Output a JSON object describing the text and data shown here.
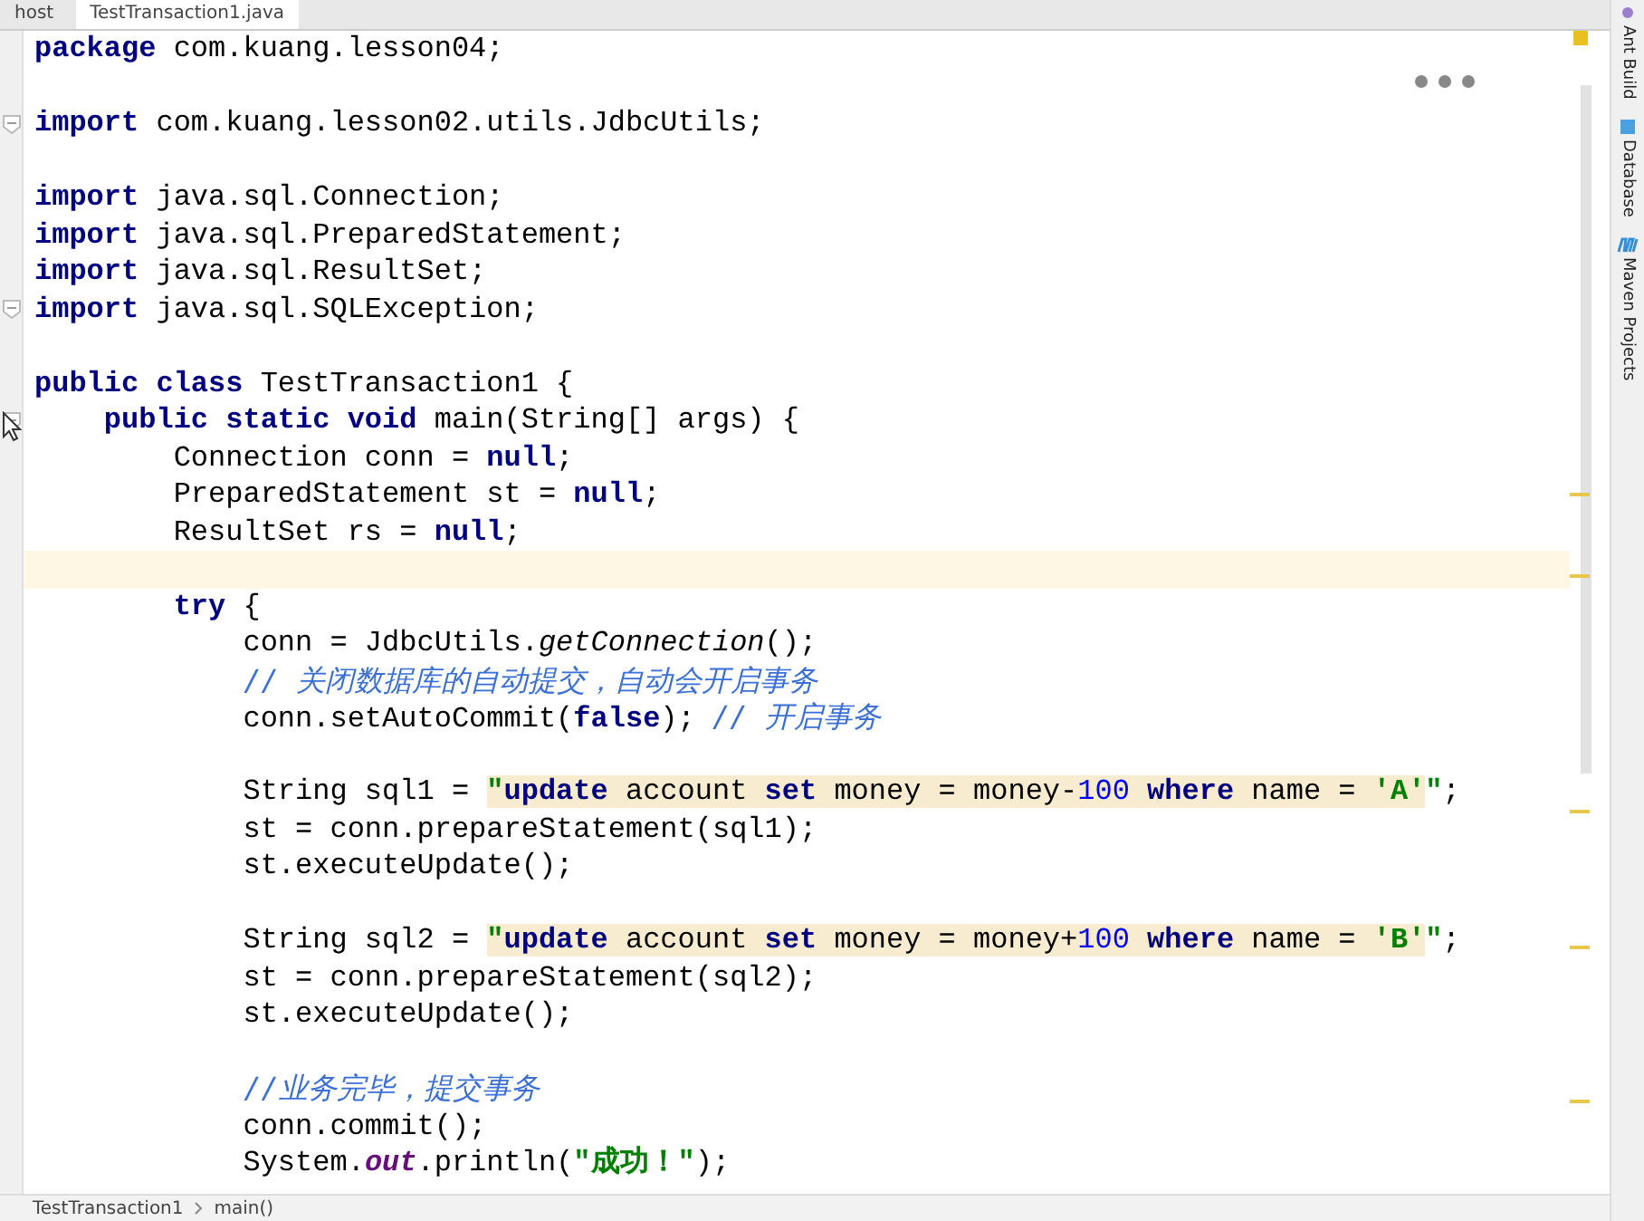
{
  "tabs": [
    {
      "label": "host",
      "selected": false
    },
    {
      "label": "TestTransaction1.java",
      "selected": true
    }
  ],
  "code_lines": [
    {
      "fold": false,
      "current": false,
      "tokens": [
        {
          "kind": "kw",
          "text": "package"
        },
        {
          "kind": "plain",
          "text": " com.kuang.lesson04;"
        }
      ]
    },
    {
      "fold": false,
      "current": false
    },
    {
      "fold": true,
      "current": false,
      "tokens": [
        {
          "kind": "kw",
          "text": "import"
        },
        {
          "kind": "plain",
          "text": " com.kuang.lesson02.utils.JdbcUtils;"
        }
      ]
    },
    {
      "fold": false,
      "current": false
    },
    {
      "fold": false,
      "current": false,
      "tokens": [
        {
          "kind": "kw",
          "text": "import"
        },
        {
          "kind": "plain",
          "text": " java.sql.Connection;"
        }
      ]
    },
    {
      "fold": false,
      "current": false,
      "tokens": [
        {
          "kind": "kw",
          "text": "import"
        },
        {
          "kind": "plain",
          "text": " java.sql.PreparedStatement;"
        }
      ]
    },
    {
      "fold": false,
      "current": false,
      "tokens": [
        {
          "kind": "kw",
          "text": "import"
        },
        {
          "kind": "plain",
          "text": " java.sql.ResultSet;"
        }
      ]
    },
    {
      "fold": true,
      "current": false,
      "tokens": [
        {
          "kind": "kw",
          "text": "import"
        },
        {
          "kind": "plain",
          "text": " java.sql.SQLException;"
        }
      ]
    },
    {
      "fold": false,
      "current": false
    },
    {
      "fold": false,
      "current": false,
      "tokens": [
        {
          "kind": "kw",
          "text": "public class"
        },
        {
          "kind": "plain",
          "text": " TestTransaction1 {"
        }
      ]
    },
    {
      "fold": true,
      "current": false,
      "tokens": [
        {
          "kind": "kw",
          "text": "    public static void"
        },
        {
          "kind": "plain",
          "text": " main(String[] args) {"
        }
      ]
    },
    {
      "fold": false,
      "current": false,
      "tokens": [
        {
          "kind": "plain",
          "text": "        Connection conn = "
        },
        {
          "kind": "kw",
          "text": "null"
        },
        {
          "kind": "plain",
          "text": ";"
        }
      ]
    },
    {
      "fold": false,
      "current": false,
      "tokens": [
        {
          "kind": "plain",
          "text": "        PreparedStatement st = "
        },
        {
          "kind": "kw",
          "text": "null"
        },
        {
          "kind": "plain",
          "text": ";"
        }
      ]
    },
    {
      "fold": false,
      "current": false,
      "tokens": [
        {
          "kind": "plain",
          "text": "        ResultSet rs = "
        },
        {
          "kind": "kw",
          "text": "null"
        },
        {
          "kind": "plain",
          "text": ";"
        }
      ]
    },
    {
      "fold": false,
      "current": true
    },
    {
      "fold": false,
      "current": false,
      "tokens": [
        {
          "kind": "kw",
          "text": "        try"
        },
        {
          "kind": "plain",
          "text": " {"
        }
      ]
    },
    {
      "fold": false,
      "current": false,
      "tokens": [
        {
          "kind": "plain",
          "text": "            conn = JdbcUtils."
        },
        {
          "kind": "method",
          "text": "getConnection"
        },
        {
          "kind": "plain",
          "text": "();"
        }
      ]
    },
    {
      "fold": false,
      "current": false,
      "tokens": [
        {
          "kind": "comment",
          "text": "            // 关闭数据库的自动提交，自动会开启事务"
        }
      ]
    },
    {
      "fold": false,
      "current": false,
      "tokens": [
        {
          "kind": "plain",
          "text": "            conn.setAutoCommit("
        },
        {
          "kind": "kw",
          "text": "false"
        },
        {
          "kind": "plain",
          "text": "); "
        },
        {
          "kind": "comment",
          "text": "// 开启事务"
        }
      ]
    },
    {
      "fold": false,
      "current": false
    },
    {
      "fold": false,
      "current": false,
      "tokens": [
        {
          "kind": "plain",
          "text": "            String sql1 = "
        },
        {
          "kind": "str",
          "text": "\""
        },
        {
          "kind": "sqlkw",
          "text": "update"
        },
        {
          "kind": "sqltext",
          "text": " account "
        },
        {
          "kind": "sqlkw",
          "text": "set"
        },
        {
          "kind": "sqltext",
          "text": " money = money-"
        },
        {
          "kind": "sqlnum",
          "text": "100"
        },
        {
          "kind": "sqlkw",
          "text": " where"
        },
        {
          "kind": "sqltext",
          "text": " name = "
        },
        {
          "kind": "sqlstr",
          "text": "'A'"
        },
        {
          "kind": "str",
          "text": "\""
        },
        {
          "kind": "plain",
          "text": ";"
        }
      ]
    },
    {
      "fold": false,
      "current": false,
      "tokens": [
        {
          "kind": "plain",
          "text": "            st = conn.prepareStatement(sql1);"
        }
      ]
    },
    {
      "fold": false,
      "current": false,
      "tokens": [
        {
          "kind": "plain",
          "text": "            st.executeUpdate();"
        }
      ]
    },
    {
      "fold": false,
      "current": false
    },
    {
      "fold": false,
      "current": false,
      "tokens": [
        {
          "kind": "plain",
          "text": "            String sql2 = "
        },
        {
          "kind": "str",
          "text": "\""
        },
        {
          "kind": "sqlkw",
          "text": "update"
        },
        {
          "kind": "sqltext",
          "text": " account "
        },
        {
          "kind": "sqlkw",
          "text": "set"
        },
        {
          "kind": "sqltext",
          "text": " money = money+"
        },
        {
          "kind": "sqlnum",
          "text": "100"
        },
        {
          "kind": "sqlkw",
          "text": " where"
        },
        {
          "kind": "sqltext",
          "text": " name = "
        },
        {
          "kind": "sqlstr",
          "text": "'B'"
        },
        {
          "kind": "str",
          "text": "\""
        },
        {
          "kind": "plain",
          "text": ";"
        }
      ]
    },
    {
      "fold": false,
      "current": false,
      "tokens": [
        {
          "kind": "plain",
          "text": "            st = conn.prepareStatement(sql2);"
        }
      ]
    },
    {
      "fold": false,
      "current": false,
      "tokens": [
        {
          "kind": "plain",
          "text": "            st.executeUpdate();"
        }
      ]
    },
    {
      "fold": false,
      "current": false
    },
    {
      "fold": false,
      "current": false,
      "tokens": [
        {
          "kind": "comment",
          "text": "            //业务完毕，提交事务"
        }
      ]
    },
    {
      "fold": false,
      "current": false,
      "tokens": [
        {
          "kind": "plain",
          "text": "            conn.commit();"
        }
      ]
    },
    {
      "fold": false,
      "current": false,
      "tokens": [
        {
          "kind": "plain",
          "text": "            System."
        },
        {
          "kind": "field",
          "text": "out"
        },
        {
          "kind": "plain",
          "text": ".println("
        },
        {
          "kind": "str",
          "text": "\"成功！\""
        },
        {
          "kind": "plain",
          "text": ");"
        }
      ]
    }
  ],
  "tool_windows": [
    {
      "kind": "ant",
      "label": "Ant Build"
    },
    {
      "kind": "database",
      "label": "Database"
    },
    {
      "kind": "maven",
      "label": "Maven Projects"
    }
  ],
  "breadcrumbs": [
    "TestTransaction1",
    "main()"
  ]
}
